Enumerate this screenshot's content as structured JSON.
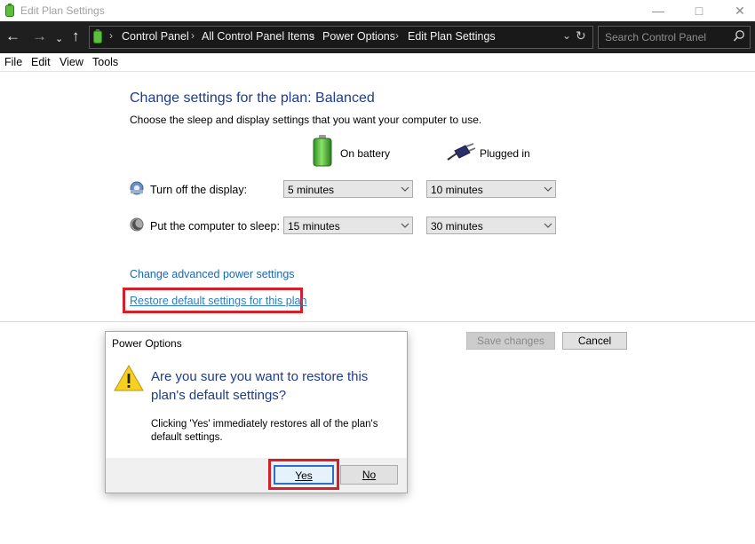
{
  "window": {
    "title": "Edit Plan Settings"
  },
  "address": {
    "crumbs": [
      "Control Panel",
      "All Control Panel Items",
      "Power Options",
      "Edit Plan Settings"
    ],
    "search_placeholder": "Search Control Panel"
  },
  "menu": [
    "File",
    "Edit",
    "View",
    "Tools"
  ],
  "page": {
    "heading": "Change settings for the plan: Balanced",
    "subheading": "Choose the sleep and display settings that you want your computer to use.",
    "columns": {
      "battery": "On battery",
      "plugged": "Plugged in"
    },
    "rows": [
      {
        "label": "Turn off the display:",
        "battery": "5 minutes",
        "plugged": "10 minutes"
      },
      {
        "label": "Put the computer to sleep:",
        "battery": "15 minutes",
        "plugged": "30 minutes"
      }
    ],
    "advanced_link": "Change advanced power settings",
    "restore_link": "Restore default settings for this plan",
    "save_label": "Save changes",
    "cancel_label": "Cancel"
  },
  "dialog": {
    "title": "Power Options",
    "main": "Are you sure you want to restore this plan's default settings?",
    "detail": "Clicking 'Yes' immediately restores all of the plan's default settings.",
    "yes": "Yes",
    "no": "No"
  },
  "colors": {
    "accent": "#1e3c8c",
    "link": "#1a66b2",
    "highlight": "#d4202a"
  },
  "icons": [
    "battery-icon",
    "back-arrow-icon",
    "forward-arrow-icon",
    "up-arrow-icon",
    "refresh-icon",
    "search-icon",
    "plug-icon",
    "display-icon",
    "sleep-icon",
    "warning-icon"
  ]
}
